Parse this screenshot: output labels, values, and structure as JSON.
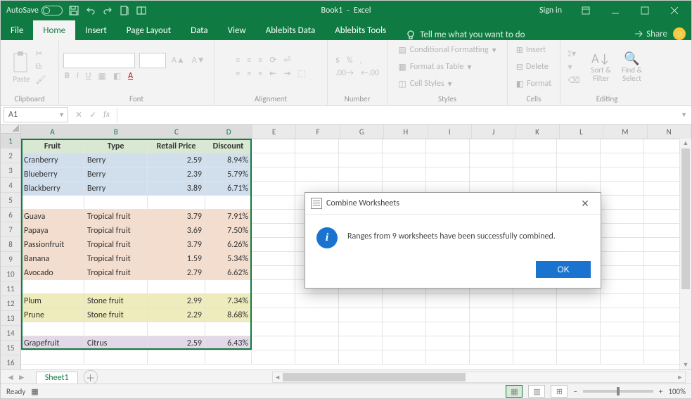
{
  "title": {
    "filename": "Book1",
    "app": "Excel",
    "autosave_label": "AutoSave",
    "autosave_state": "Off",
    "signin": "Sign in"
  },
  "tabs": {
    "file": "File",
    "items": [
      "Home",
      "Insert",
      "Page Layout",
      "Data",
      "View",
      "Ablebits Data",
      "Ablebits Tools"
    ],
    "active": "Home",
    "tellme": "Tell me what you want to do",
    "share": "Share"
  },
  "ribbon": {
    "clipboard": {
      "label": "Clipboard",
      "paste": "Paste"
    },
    "font": {
      "label": "Font",
      "bold": "B",
      "italic": "I",
      "underline": "U"
    },
    "alignment": {
      "label": "Alignment"
    },
    "number": {
      "label": "Number",
      "currency": "$",
      "percent": "%",
      "comma": ","
    },
    "styles": {
      "label": "Styles",
      "cond": "Conditional Formatting",
      "table": "Format as Table",
      "cell": "Cell Styles"
    },
    "cells": {
      "label": "Cells",
      "insert": "Insert",
      "delete": "Delete",
      "format": "Format"
    },
    "editing": {
      "label": "Editing",
      "sort": "Sort & Filter",
      "find": "Find & Select"
    }
  },
  "formula": {
    "name": "A1",
    "fx": "fx"
  },
  "grid": {
    "col_widths": {
      "A": 90,
      "B": 90,
      "C": 82,
      "D": 66,
      "rest": 62
    },
    "col_letters": [
      "A",
      "B",
      "C",
      "D",
      "E",
      "F",
      "G",
      "H",
      "I",
      "J",
      "K",
      "L",
      "M",
      "N"
    ],
    "headers": [
      "Fruit",
      "Type",
      "Retail Price",
      "Discount"
    ],
    "header_bg": "#d9e8d3",
    "rows": [
      {
        "n": 2,
        "c": [
          "Cranberry",
          "Berry",
          "2.59",
          "8.94%"
        ],
        "bg": "#d1dfed"
      },
      {
        "n": 3,
        "c": [
          "Blueberry",
          "Berry",
          "2.39",
          "5.79%"
        ],
        "bg": "#d1dfed"
      },
      {
        "n": 4,
        "c": [
          "Blackberry",
          "Berry",
          "3.89",
          "6.71%"
        ],
        "bg": "#d1dfed"
      },
      {
        "n": 5,
        "c": [
          "",
          "",
          "",
          ""
        ],
        "bg": ""
      },
      {
        "n": 6,
        "c": [
          "Guava",
          "Tropical fruit",
          "3.79",
          "7.91%"
        ],
        "bg": "#f3ddce"
      },
      {
        "n": 7,
        "c": [
          "Papaya",
          "Tropical fruit",
          "3.69",
          "7.50%"
        ],
        "bg": "#f3ddce"
      },
      {
        "n": 8,
        "c": [
          "Passionfruit",
          "Tropical fruit",
          "3.79",
          "6.26%"
        ],
        "bg": "#f3ddce"
      },
      {
        "n": 9,
        "c": [
          "Banana",
          "Tropical fruit",
          "1.59",
          "5.34%"
        ],
        "bg": "#f3ddce"
      },
      {
        "n": 10,
        "c": [
          "Avocado",
          "Tropical fruit",
          "2.79",
          "6.62%"
        ],
        "bg": "#f3ddce"
      },
      {
        "n": 11,
        "c": [
          "",
          "",
          "",
          ""
        ],
        "bg": ""
      },
      {
        "n": 12,
        "c": [
          "Plum",
          "Stone fruit",
          "2.99",
          "7.34%"
        ],
        "bg": "#eeebbc"
      },
      {
        "n": 13,
        "c": [
          "Prune",
          "Stone fruit",
          "2.29",
          "8.68%"
        ],
        "bg": "#eeebbc"
      },
      {
        "n": 14,
        "c": [
          "",
          "",
          "",
          ""
        ],
        "bg": ""
      },
      {
        "n": 15,
        "c": [
          "Grapefruit",
          "Citrus",
          "2.59",
          "6.43%"
        ],
        "bg": "#e3d8e8"
      }
    ]
  },
  "sheets": {
    "active": "Sheet1"
  },
  "status": {
    "ready": "Ready",
    "zoom": "100%"
  },
  "dialog": {
    "title": "Combine Worksheets",
    "message": "Ranges from 9 worksheets have been successfully combined.",
    "ok": "OK"
  }
}
